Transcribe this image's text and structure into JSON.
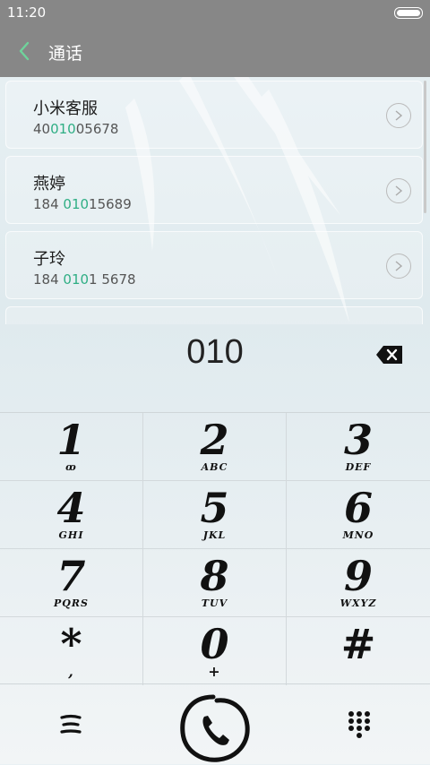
{
  "status_bar": {
    "time": "11:20"
  },
  "header": {
    "title": "通话",
    "back_icon": "chevron-left-icon",
    "accent": "#6fd39b"
  },
  "contacts": [
    {
      "name": "小米客服",
      "number_pre": "40",
      "number_match": "010",
      "number_post": "05678"
    },
    {
      "name": "燕婷",
      "number_pre": "184 ",
      "number_match": "010",
      "number_post": "15689"
    },
    {
      "name": "子玲",
      "number_pre": "184 ",
      "number_match": "010",
      "number_post": "1 5678"
    }
  ],
  "dialer": {
    "entered_number": "010",
    "backspace_icon": "backspace-icon"
  },
  "keypad": [
    {
      "digit": "1",
      "letters": "ꝏ"
    },
    {
      "digit": "2",
      "letters": "ABC"
    },
    {
      "digit": "3",
      "letters": "DEF"
    },
    {
      "digit": "4",
      "letters": "GHI"
    },
    {
      "digit": "5",
      "letters": "JKL"
    },
    {
      "digit": "6",
      "letters": "MNO"
    },
    {
      "digit": "7",
      "letters": "PQRS"
    },
    {
      "digit": "8",
      "letters": "TUV"
    },
    {
      "digit": "9",
      "letters": "WXYZ"
    },
    {
      "digit": "*",
      "letters": ","
    },
    {
      "digit": "0",
      "letters": "+"
    },
    {
      "digit": "#",
      "letters": ""
    }
  ],
  "bottom_bar": {
    "menu_icon": "menu-icon",
    "call_icon": "phone-call-icon",
    "keypad_icon": "dialpad-icon"
  },
  "colors": {
    "highlight": "#2fae84",
    "header_bg": "#878787"
  }
}
